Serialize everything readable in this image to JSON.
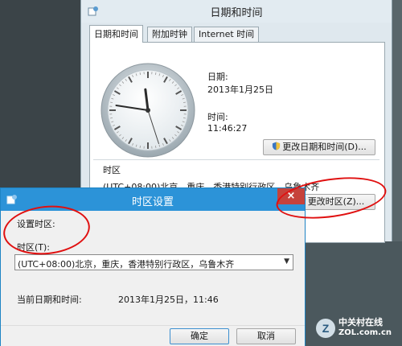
{
  "main_window": {
    "title": "日期和时间",
    "tabs": [
      {
        "label": "日期和时间",
        "active": true
      },
      {
        "label": "附加时钟",
        "active": false
      },
      {
        "label": "Internet 时间",
        "active": false
      }
    ],
    "date_label": "日期:",
    "date_value": "2013年1月25日",
    "time_label": "时间:",
    "time_value": "11:46:27",
    "change_datetime_button": "更改日期和时间(D)...",
    "timezone_heading": "时区",
    "timezone_value": "(UTC+08:00)北京，重庆，香港特别行政区，乌鲁木齐",
    "change_timezone_button": "更改时区(Z)..."
  },
  "clock": {
    "hour": 11,
    "minute": 46,
    "second": 27
  },
  "dialog": {
    "title": "时区设置",
    "close_glyph": "×",
    "section_label": "设置时区:",
    "timezone_field_label": "时区(T):",
    "timezone_selected": "(UTC+08:00)北京，重庆，香港特别行政区，乌鲁木齐",
    "current_datetime_label": "当前日期和时间:",
    "current_datetime_value": "2013年1月25日，11:46",
    "ok_button": "确定",
    "cancel_button": "取消"
  },
  "watermark": {
    "cn": "中关村在线",
    "en": "ZOL.com.cn"
  },
  "colors": {
    "annotation": "#e01010",
    "dialog_title": "#2c93d8",
    "close": "#c6423b"
  }
}
